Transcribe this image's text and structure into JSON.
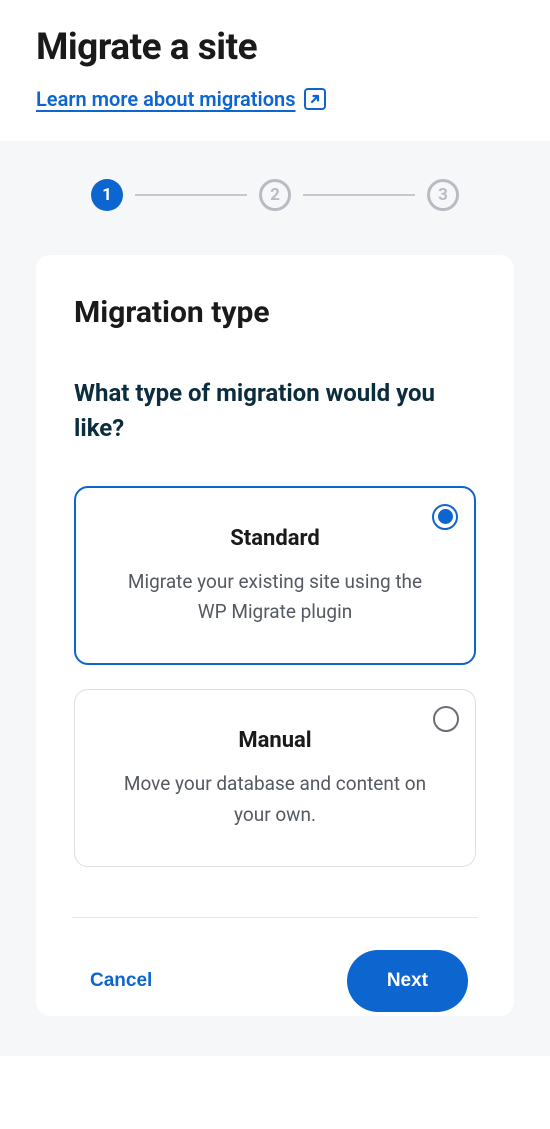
{
  "header": {
    "title": "Migrate a site",
    "learn_more": "Learn more about migrations"
  },
  "stepper": {
    "steps": [
      "1",
      "2",
      "3"
    ],
    "active_index": 0
  },
  "card": {
    "title": "Migration type",
    "question": "What type of migration would you like?"
  },
  "options": [
    {
      "title": "Standard",
      "desc": "Migrate your existing site using the WP Migrate plugin",
      "selected": true
    },
    {
      "title": "Manual",
      "desc": "Move your database and content on your own.",
      "selected": false
    }
  ],
  "footer": {
    "cancel": "Cancel",
    "next": "Next"
  }
}
